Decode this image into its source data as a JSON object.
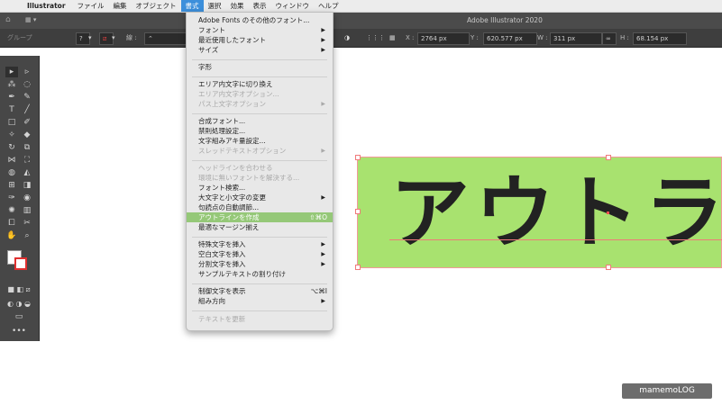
{
  "menubar": {
    "apple_glyph": "",
    "app_name": "Illustrator",
    "items": [
      "ファイル",
      "編集",
      "オブジェクト",
      "書式",
      "選択",
      "効果",
      "表示",
      "ウィンドウ",
      "ヘルプ"
    ]
  },
  "window": {
    "title": "Adobe Illustrator 2020"
  },
  "controlbar": {
    "selection_label": "グループ",
    "stroke_label": "線 :",
    "x_label": "X :",
    "x_value": "2764 px",
    "y_label": "Y :",
    "y_value": "620.577 px",
    "w_label": "W :",
    "w_value": "311 px",
    "h_label": "H :",
    "h_value": "68.154 px"
  },
  "type_menu": {
    "items": [
      {
        "label": "Adobe Fonts のその他のフォント...",
        "submenu": false,
        "disabled": false
      },
      {
        "label": "フォント",
        "submenu": true,
        "disabled": false
      },
      {
        "label": "最近使用したフォント",
        "submenu": true,
        "disabled": false
      },
      {
        "label": "サイズ",
        "submenu": true,
        "disabled": false
      },
      {
        "label": "字形",
        "submenu": false,
        "disabled": false
      },
      {
        "label": "エリア内文字に切り換え",
        "submenu": false,
        "disabled": false
      },
      {
        "label": "エリア内文字オプション...",
        "submenu": false,
        "disabled": true
      },
      {
        "label": "パス上文字オプション",
        "submenu": true,
        "disabled": true
      },
      {
        "label": "合成フォント...",
        "submenu": false,
        "disabled": false
      },
      {
        "label": "禁則処理設定...",
        "submenu": false,
        "disabled": false
      },
      {
        "label": "文字組みアキ量設定...",
        "submenu": false,
        "disabled": false
      },
      {
        "label": "スレッドテキストオプション",
        "submenu": true,
        "disabled": true
      },
      {
        "label": "ヘッドラインを合わせる",
        "submenu": false,
        "disabled": true
      },
      {
        "label": "環境に無いフォントを解決する...",
        "submenu": false,
        "disabled": true
      },
      {
        "label": "フォント検索...",
        "submenu": false,
        "disabled": false
      },
      {
        "label": "大文字と小文字の変更",
        "submenu": true,
        "disabled": false
      },
      {
        "label": "句読点の自動調節...",
        "submenu": false,
        "disabled": false
      },
      {
        "label": "アウトラインを作成",
        "submenu": false,
        "disabled": false,
        "highlighted": true,
        "shortcut": "⇧⌘O"
      },
      {
        "label": "最適なマージン揃え",
        "submenu": false,
        "disabled": false
      },
      {
        "label": "特殊文字を挿入",
        "submenu": true,
        "disabled": false
      },
      {
        "label": "空白文字を挿入",
        "submenu": true,
        "disabled": false
      },
      {
        "label": "分割文字を挿入",
        "submenu": true,
        "disabled": false
      },
      {
        "label": "サンプルテキストの割り付け",
        "submenu": false,
        "disabled": false
      },
      {
        "label": "制御文字を表示",
        "submenu": false,
        "disabled": false,
        "shortcut": "⌥⌘I"
      },
      {
        "label": "組み方向",
        "submenu": true,
        "disabled": false
      },
      {
        "label": "テキストを更新",
        "submenu": false,
        "disabled": true
      }
    ]
  },
  "artwork": {
    "text": "アウトライ",
    "background_color": "#a8e26f"
  },
  "watermark": "mamemoLOG",
  "colors": {
    "highlight": "#95c878",
    "menu_active": "#3c8fdb",
    "selection": "#f07a7a"
  }
}
